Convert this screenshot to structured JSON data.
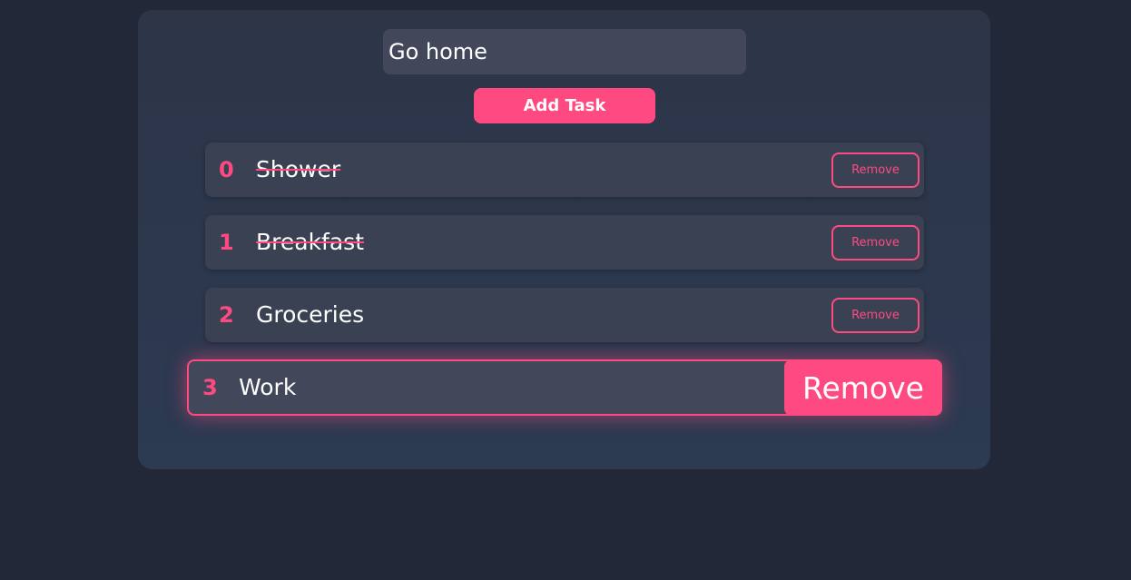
{
  "input": {
    "value": "Go home",
    "placeholder": ""
  },
  "add_button_label": "Add Task",
  "tasks": [
    {
      "number": "0",
      "text": "Shower",
      "completed": true,
      "remove_label": "Remove"
    },
    {
      "number": "1",
      "text": "Breakfast",
      "completed": true,
      "remove_label": "Remove"
    },
    {
      "number": "2",
      "text": "Groceries",
      "completed": false,
      "remove_label": "Remove"
    },
    {
      "number": "3",
      "text": "Work",
      "completed": false,
      "remove_label": "Remove",
      "hovered": true
    }
  ],
  "colors": {
    "background": "#232838",
    "card": "#2d3547",
    "accent": "#ff4a81",
    "row": "#3a4153",
    "input": "#42485a",
    "text": "#ffffff"
  }
}
